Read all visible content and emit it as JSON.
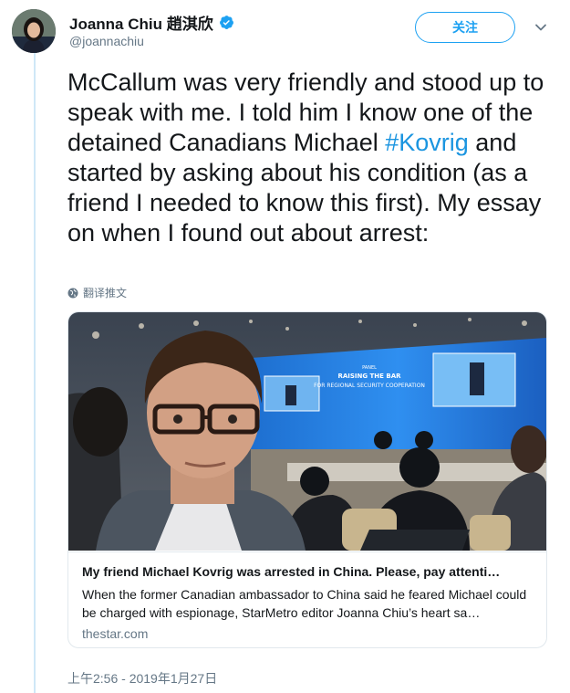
{
  "author": {
    "display_name": "Joanna Chiu 趙淇欣",
    "handle": "@joannachiu",
    "verified": true
  },
  "follow_button": {
    "label": "关注"
  },
  "tweet": {
    "text_before_hashtag": "McCallum was very friendly and stood up to speak with me. I told him I know one of the detained Canadians Michael ",
    "hashtag": "#Kovrig",
    "text_after_hashtag": " and started by asking about his condition (as a friend I needed to know this first). My essay on when I found out about arrest:"
  },
  "translate": {
    "label": "翻译推文",
    "icon": "globe-icon"
  },
  "link_card": {
    "title": "My friend Michael Kovrig was arrested in China. Please, pay attenti…",
    "description": "When the former Canadian ambassador to China said he feared Michael could be charged with espionage, StarMetro editor Joanna Chiu’s heart sa…",
    "domain": "thestar.com",
    "image": {
      "description": "selfie of a man with glasses in front of a conference hall with blue screens",
      "stage_text_lines": [
        "PANEL",
        "RAISING THE BAR",
        "FOR REGIONAL SECURITY COOPERATION"
      ]
    }
  },
  "timestamp": "上午2:56 - 2019年1月27日",
  "colors": {
    "accent": "#1da1f2",
    "hashtag": "#1b95e0",
    "secondary_text": "#657786",
    "thread_line": "#cfe8f7"
  }
}
